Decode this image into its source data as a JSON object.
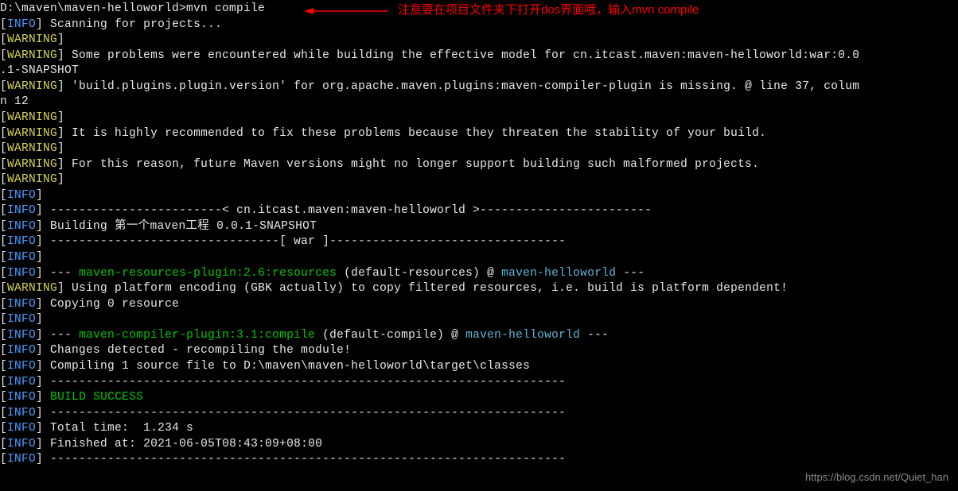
{
  "prompt": "D:\\maven\\maven-helloworld>mvn compile",
  "annotation": "注意要在项目文件夹下打开dos界面哦，输入mvn compile",
  "watermark": "https://blog.csdn.net/Quiet_han",
  "tags": {
    "info": "INFO",
    "warning": "WARNING"
  },
  "lines": {
    "scanning": " Scanning for projects...",
    "warn_problems": " Some problems were encountered while building the effective model for cn.itcast.maven:maven-helloworld:war:0.0",
    "snapshot_cont": ".1-SNAPSHOT",
    "warn_version": " 'build.plugins.plugin.version' for org.apache.maven.plugins:maven-compiler-plugin is missing. @ line 37, colum",
    "n12": "n 12",
    "warn_recommend": " It is highly recommended to fix these problems because they threaten the stability of your build.",
    "warn_future": " For this reason, future Maven versions might no longer support building such malformed projects.",
    "dash_project": " ------------------------< cn.itcast.maven:maven-helloworld >------------------------",
    "building": " Building 第一个maven工程 0.0.1-SNAPSHOT",
    "dash_war": " --------------------------------[ war ]---------------------------------",
    "plugin_res_pre": " --- ",
    "plugin_res": "maven-resources-plugin:2.6:resources",
    "plugin_res_mid": " (default-resources) @ ",
    "plugin_res_name": "maven-helloworld",
    "plugin_res_post": " ---",
    "warn_encoding": " Using platform encoding (GBK actually) to copy filtered resources, i.e. build is platform dependent!",
    "copying": " Copying 0 resource",
    "plugin_comp": "maven-compiler-plugin:3.1:compile",
    "plugin_comp_mid": " (default-compile) @ ",
    "changes": " Changes detected - recompiling the module!",
    "compiling": " Compiling 1 source file to D:\\maven\\maven-helloworld\\target\\classes",
    "dashline": " ------------------------------------------------------------------------",
    "build_success": "BUILD SUCCESS",
    "total_time": " Total time:  1.234 s",
    "finished": " Finished at: 2021-06-05T08:43:09+08:00"
  }
}
